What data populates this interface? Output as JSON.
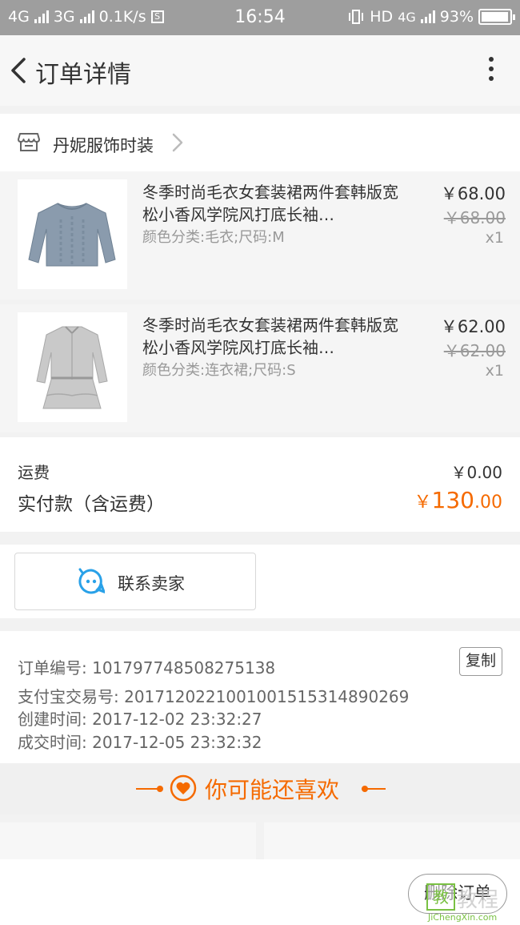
{
  "status_bar": {
    "network1": "4G",
    "network2": "3G",
    "speed": "0.1K/s",
    "s_badge": "S",
    "time": "16:54",
    "hd": "HD",
    "network3": "4G",
    "battery": "93%"
  },
  "nav": {
    "title": "订单详情"
  },
  "shop": {
    "name": "丹妮服饰时装"
  },
  "items": [
    {
      "title": "冬季时尚毛衣女套装裙两件套韩版宽松小香风学院风打底长袖…",
      "sku": "颜色分类:毛衣;尺码:M",
      "price": "￥68.00",
      "original_price": "￥68.00",
      "quantity": "x1"
    },
    {
      "title": "冬季时尚毛衣女套装裙两件套韩版宽松小香风学院风打底长袖…",
      "sku": "颜色分类:连衣裙;尺码:S",
      "price": "￥62.00",
      "original_price": "￥62.00",
      "quantity": "x1"
    }
  ],
  "costs": {
    "shipping_label": "运费",
    "shipping_value": "￥0.00",
    "total_label": "实付款（含运费）",
    "total_currency": "￥",
    "total_integer": "130",
    "total_decimal": ".00"
  },
  "contact": {
    "label": "联系卖家"
  },
  "order_info": {
    "order_number": "订单编号: 101797748508275138",
    "alipay_number": "支付宝交易号: 2017120221001001515314890269",
    "created_time": "创建时间: 2017-12-02 23:32:27",
    "deal_time": "成交时间: 2017-12-05 23:32:32",
    "copy_label": "复制"
  },
  "recommend": {
    "label": "你可能还喜欢"
  },
  "bottom": {
    "delete_label": "删除订单"
  },
  "watermark": {
    "text": "教程",
    "url": "JiChengXin.com",
    "box": "教"
  },
  "colors": {
    "accent": "#f56a00",
    "contact_icon": "#29a1e8",
    "watermark_green": "#7ac143"
  }
}
